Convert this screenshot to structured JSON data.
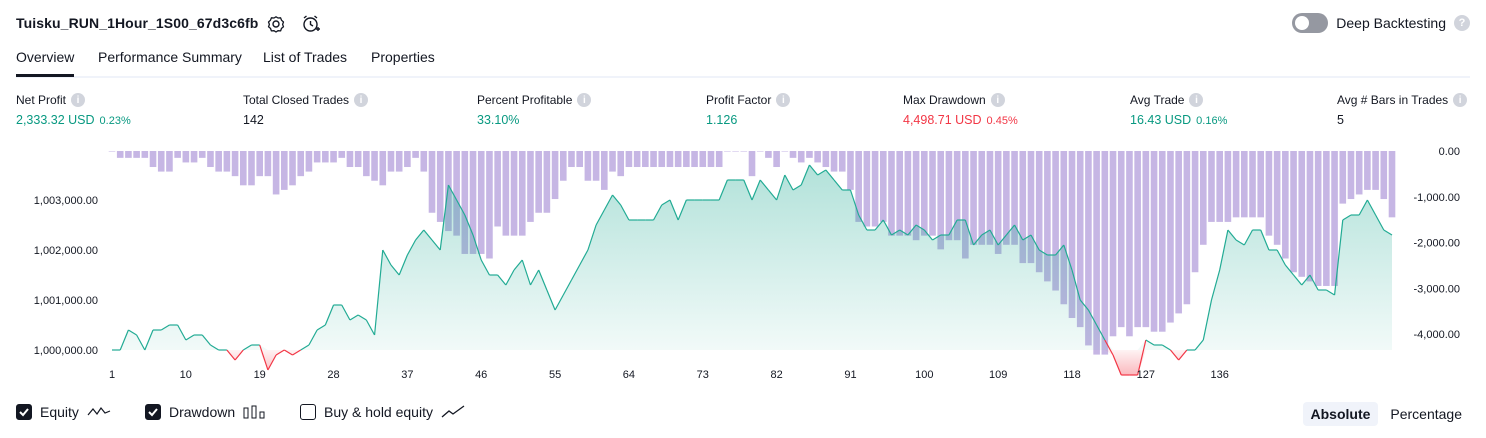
{
  "header": {
    "strategy_name": "Tuisku_RUN_1Hour_1S00_67d3c6fb",
    "deep_backtesting_label": "Deep Backtesting",
    "deep_backtesting_enabled": false
  },
  "tabs": [
    {
      "label": "Overview",
      "active": true
    },
    {
      "label": "Performance Summary",
      "active": false
    },
    {
      "label": "List of Trades",
      "active": false
    },
    {
      "label": "Properties",
      "active": false
    }
  ],
  "metrics": [
    {
      "label": "Net Profit",
      "value": "2,333.32 USD",
      "pct": "0.23%",
      "tone": "pos"
    },
    {
      "label": "Total Closed Trades",
      "value": "142",
      "pct": "",
      "tone": "neu"
    },
    {
      "label": "Percent Profitable",
      "value": "33.10%",
      "pct": "",
      "tone": "pos"
    },
    {
      "label": "Profit Factor",
      "value": "1.126",
      "pct": "",
      "tone": "pos"
    },
    {
      "label": "Max Drawdown",
      "value": "4,498.71 USD",
      "pct": "0.45%",
      "tone": "neg"
    },
    {
      "label": "Avg Trade",
      "value": "16.43 USD",
      "pct": "0.16%",
      "tone": "pos"
    },
    {
      "label": "Avg # Bars in Trades",
      "value": "5",
      "pct": "",
      "tone": "neu"
    }
  ],
  "chart_data": {
    "type": "area",
    "trades_x_ticks": [
      1,
      10,
      19,
      28,
      37,
      46,
      55,
      64,
      73,
      82,
      91,
      100,
      109,
      118,
      127,
      136
    ],
    "equity": {
      "name": "Equity",
      "ylim": [
        999500,
        1004000
      ],
      "ticks": [
        1003000,
        1002000,
        1001000,
        1000000
      ],
      "tick_labels": [
        "1,003,000.00",
        "1,002,000.00",
        "1,001,000.00",
        "1,000,000.00"
      ],
      "baseline": 1000000,
      "values": [
        1000000,
        1000000,
        1000400,
        1000300,
        1000000,
        1000400,
        1000400,
        1000500,
        1000500,
        1000200,
        1000300,
        1000300,
        1000100,
        1000000,
        1000000,
        999800,
        1000000,
        1000100,
        1000100,
        999600,
        999900,
        1000000,
        999900,
        1000000,
        1000100,
        1000400,
        1000500,
        1000900,
        1000900,
        1000600,
        1000700,
        1000600,
        1000300,
        1002000,
        1001700,
        1001500,
        1001900,
        1002200,
        1002400,
        1002200,
        1002000,
        1003300,
        1003000,
        1002700,
        1002300,
        1001800,
        1001500,
        1001500,
        1001300,
        1001600,
        1001800,
        1001300,
        1001600,
        1001200,
        1000800,
        1001100,
        1001400,
        1001700,
        1002000,
        1002500,
        1002800,
        1003100,
        1002900,
        1002600,
        1002600,
        1002600,
        1002600,
        1002900,
        1003000,
        1002600,
        1003000,
        1003000,
        1003000,
        1003000,
        1003000,
        1003400,
        1003400,
        1003400,
        1003000,
        1003400,
        1003200,
        1003000,
        1003500,
        1003200,
        1003300,
        1003700,
        1003500,
        1003600,
        1003400,
        1003200,
        1003200,
        1002700,
        1002400,
        1002400,
        1002600,
        1002300,
        1002400,
        1002300,
        1002500,
        1002400,
        1002200,
        1002300,
        1002300,
        1002600,
        1002600,
        1002100,
        1002300,
        1002400,
        1002100,
        1002300,
        1002500,
        1002200,
        1002300,
        1002000,
        1001900,
        1001900,
        1002100,
        1001600,
        1001000,
        1000800,
        1000500,
        1000200,
        999900,
        999500,
        999500,
        999500,
        1000200,
        1000100,
        1000100,
        1000000,
        999800,
        1000000,
        1000000,
        1000200,
        1001000,
        1001600,
        1002400,
        1002200,
        1002100,
        1002400,
        1002400,
        1002000,
        1002000,
        1001700,
        1001500,
        1001300,
        1001500,
        1001200,
        1001200,
        1001100,
        1002600,
        1002700,
        1002700,
        1003000,
        1002700,
        1002400,
        1002300
      ]
    },
    "drawdown": {
      "name": "Drawdown",
      "ylim": [
        -4000,
        0
      ],
      "ticks": [
        0,
        -1000,
        -2000,
        -3000,
        -4000
      ],
      "tick_labels": [
        "0.00",
        "-1,000.00",
        "-2,000.00",
        "-3,000.00",
        "-4,000.00"
      ],
      "values": [
        0,
        -150,
        -150,
        -150,
        -150,
        -350,
        -450,
        -450,
        -150,
        -250,
        -250,
        -150,
        -350,
        -450,
        -450,
        -550,
        -750,
        -750,
        -550,
        -550,
        -950,
        -850,
        -750,
        -550,
        -450,
        -250,
        -250,
        -250,
        -150,
        -350,
        -350,
        -550,
        -650,
        -750,
        -450,
        -450,
        -350,
        -150,
        -450,
        -1350,
        -1550,
        -1750,
        -1850,
        -2250,
        -2250,
        -2250,
        -2350,
        -1650,
        -1850,
        -1850,
        -1850,
        -1550,
        -1350,
        -1350,
        -1050,
        -650,
        -350,
        -350,
        -650,
        -650,
        -850,
        -450,
        -550,
        -350,
        -350,
        -350,
        -350,
        -350,
        -350,
        -350,
        -350,
        -350,
        -350,
        -350,
        -350,
        0,
        0,
        0,
        -550,
        0,
        -150,
        -350,
        0,
        -150,
        -250,
        -150,
        -250,
        -350,
        -450,
        -450,
        -850,
        -1550,
        -1650,
        -1650,
        -1550,
        -1850,
        -1850,
        -1850,
        -1950,
        -1850,
        -1850,
        -2150,
        -1950,
        -1950,
        -2350,
        -2050,
        -2050,
        -2050,
        -2250,
        -2050,
        -2050,
        -2450,
        -2450,
        -2650,
        -2850,
        -3050,
        -3350,
        -3650,
        -3850,
        -4250,
        -4450,
        -4450,
        -4050,
        -3850,
        -4050,
        -3850,
        -3850,
        -3950,
        -3950,
        -3750,
        -3550,
        -3350,
        -2650,
        -2050,
        -1550,
        -1550,
        -1550,
        -1450,
        -1450,
        -1450,
        -1450,
        -1850,
        -2050,
        -2350,
        -2650,
        -2750,
        -2850,
        -2950,
        -2950,
        -2950,
        -1150,
        -1050,
        -950,
        -850,
        -850,
        -1050,
        -1450
      ]
    },
    "legend": [
      {
        "label": "Equity",
        "checked": true,
        "icon": "equity-line-icon"
      },
      {
        "label": "Drawdown",
        "checked": true,
        "icon": "drawdown-bars-icon"
      },
      {
        "label": "Buy & hold equity",
        "checked": false,
        "icon": "buy-hold-line-icon"
      }
    ],
    "scale_modes": [
      {
        "label": "Absolute",
        "active": true
      },
      {
        "label": "Percentage",
        "active": false
      }
    ],
    "colors": {
      "equity_line": "#22ab94",
      "equity_fill_top": "#22ab94",
      "loss_line": "#f23645",
      "drawdown_bar": "#b39ddb",
      "positive": "#089981",
      "negative": "#f23645"
    }
  }
}
